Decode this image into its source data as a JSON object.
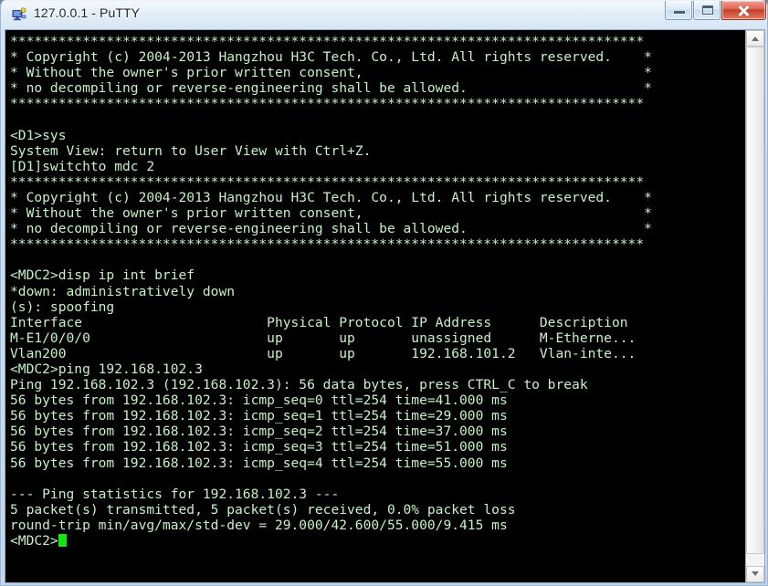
{
  "window": {
    "title": "127.0.0.1 - PuTTY",
    "icon": "putty-computer-icon",
    "minimize_label": "Minimize",
    "maximize_label": "Maximize",
    "close_label": "Close"
  },
  "colors": {
    "terminal_background": "#000000",
    "terminal_foreground": "#c6f2c6",
    "cursor": "#11e611",
    "titlebar_text": "#17212b",
    "close_button": "#c3402a"
  },
  "scrollbar": {
    "up_arrow": "scroll-up-arrow",
    "down_arrow": "scroll-down-arrow",
    "thumb": "scroll-thumb"
  },
  "terminal": {
    "prompts": [
      "<D1>",
      "[D1]",
      "<MDC2>"
    ],
    "commands": [
      "sys",
      "switchto mdc 2",
      "disp ip int brief",
      "ping 192.168.102.3"
    ],
    "interface_table": {
      "headers": [
        "Interface",
        "Physical",
        "Protocol",
        "IP Address",
        "Description"
      ],
      "rows": [
        [
          "M-E1/0/0/0",
          "up",
          "up",
          "unassigned",
          "M-Etherne..."
        ],
        [
          "Vlan200",
          "up",
          "up",
          "192.168.101.2",
          "Vlan-inte..."
        ]
      ]
    },
    "ping": {
      "target": "192.168.102.3",
      "data_bytes": 56,
      "replies": [
        {
          "seq": 0,
          "ttl": 254,
          "time": "41.000"
        },
        {
          "seq": 1,
          "ttl": 254,
          "time": "29.000"
        },
        {
          "seq": 2,
          "ttl": 254,
          "time": "37.000"
        },
        {
          "seq": 3,
          "ttl": 254,
          "time": "51.000"
        },
        {
          "seq": 4,
          "ttl": 254,
          "time": "55.000"
        }
      ],
      "transmitted": 5,
      "received": 5,
      "loss_percent": "0.0%",
      "min": "29.000",
      "avg": "42.600",
      "max": "55.000",
      "std_dev": "9.415"
    },
    "screen_text": "*******************************************************************************\n* Copyright (c) 2004-2013 Hangzhou H3C Tech. Co., Ltd. All rights reserved.    *\n* Without the owner's prior written consent,                                   *\n* no decompiling or reverse-engineering shall be allowed.                      *\n*******************************************************************************\n\n<D1>sys\nSystem View: return to User View with Ctrl+Z.\n[D1]switchto mdc 2\n*******************************************************************************\n* Copyright (c) 2004-2013 Hangzhou H3C Tech. Co., Ltd. All rights reserved.    *\n* Without the owner's prior written consent,                                   *\n* no decompiling or reverse-engineering shall be allowed.                      *\n*******************************************************************************\n\n<MDC2>disp ip int brief\n*down: administratively down\n(s): spoofing\nInterface                       Physical Protocol IP Address      Description\nM-E1/0/0/0                      up       up       unassigned      M-Etherne...\nVlan200                         up       up       192.168.101.2   Vlan-inte...\n<MDC2>ping 192.168.102.3\nPing 192.168.102.3 (192.168.102.3): 56 data bytes, press CTRL_C to break\n56 bytes from 192.168.102.3: icmp_seq=0 ttl=254 time=41.000 ms\n56 bytes from 192.168.102.3: icmp_seq=1 ttl=254 time=29.000 ms\n56 bytes from 192.168.102.3: icmp_seq=2 ttl=254 time=37.000 ms\n56 bytes from 192.168.102.3: icmp_seq=3 ttl=254 time=51.000 ms\n56 bytes from 192.168.102.3: icmp_seq=4 ttl=254 time=55.000 ms\n\n--- Ping statistics for 192.168.102.3 ---\n5 packet(s) transmitted, 5 packet(s) received, 0.0% packet loss\nround-trip min/avg/max/std-dev = 29.000/42.600/55.000/9.415 ms\n<MDC2>"
  }
}
